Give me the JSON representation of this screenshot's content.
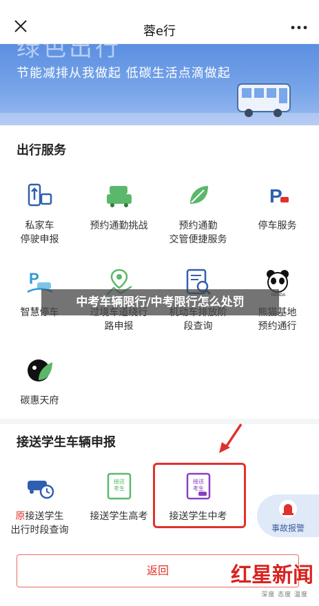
{
  "header": {
    "title": "蓉e行"
  },
  "banner": {
    "big_text": "绿色出行",
    "slogan": "节能减排从我做起 低碳生活点滴做起"
  },
  "travel_services": {
    "title": "出行服务",
    "items": [
      {
        "line1": "私家车",
        "line2": "停驶申报",
        "icon": "car-transfer-icon"
      },
      {
        "line1": "预约通勤挑战",
        "line2": "",
        "icon": "cars-icon"
      },
      {
        "line1": "预约通勤",
        "line2": "交管便捷服务",
        "icon": "leaf-icon"
      },
      {
        "line1": "停车服务",
        "line2": "",
        "icon": "parking-icon"
      },
      {
        "line1": "智慧停车",
        "line2": "",
        "icon": "smart-parking-icon"
      },
      {
        "line1": "过境车道绕行",
        "line2": "路申报",
        "icon": "map-route-icon"
      },
      {
        "line1": "机动车排放阶",
        "line2": "段查询",
        "icon": "document-search-icon"
      },
      {
        "line1": "熊猫基地",
        "line2": "预约通行",
        "icon": "panda-icon"
      },
      {
        "line1": "碳惠天府",
        "line2": "",
        "icon": "panda-leaf-icon"
      }
    ]
  },
  "overlay_caption": "中考车辆限行/中考限行怎么处罚",
  "student_section": {
    "title": "接送学生车辆申报",
    "items": [
      {
        "prefix": "原",
        "line1": "接送学生",
        "line2": "出行时段查询",
        "icon": "car-clock-icon"
      },
      {
        "line1": "接送学生高考",
        "line2": "",
        "icon_text": "接送考生",
        "icon": "exam-card-green-icon"
      },
      {
        "line1": "接送学生中考",
        "line2": "",
        "icon_text": "接送考生",
        "icon": "exam-card-purple-icon"
      }
    ]
  },
  "report_fab": {
    "label": "事故报警"
  },
  "back_button": {
    "label": "返回"
  },
  "brand": {
    "name": "红星新闻",
    "tagline": "深度 态度 温度"
  },
  "colors": {
    "accent_red": "#e0312a",
    "banner_blue": "#6c9be6",
    "icon_green": "#5bb86a",
    "icon_blue": "#2f5fb0"
  }
}
